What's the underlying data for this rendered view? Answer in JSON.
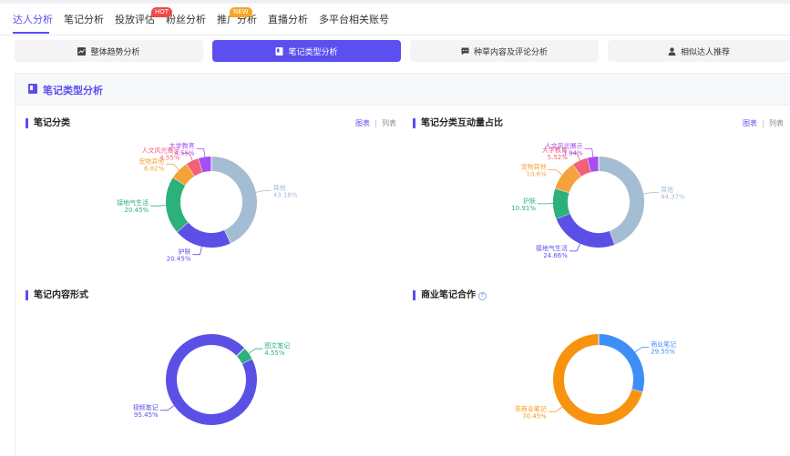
{
  "nav": {
    "items": [
      "达人分析",
      "笔记分析",
      "投放评估",
      "粉丝分析",
      "推广分析",
      "直播分析",
      "多平台相关账号"
    ],
    "active_index": 0,
    "badges": {
      "hot": "HOT",
      "new": "NEW"
    }
  },
  "subtabs": [
    {
      "label": "整体趋势分析",
      "icon": "trend-chart-icon"
    },
    {
      "label": "笔记类型分析",
      "icon": "note-icon"
    },
    {
      "label": "种草内容及评论分析",
      "icon": "comment-icon"
    },
    {
      "label": "相似达人推荐",
      "icon": "user-icon"
    }
  ],
  "active_subtab": 1,
  "panel": {
    "title": "笔记类型分析",
    "icon": "note-icon"
  },
  "toggle": {
    "chart": "图表",
    "list": "列表"
  },
  "colors": {
    "accent": "#5b4ff0",
    "other": "#a5bdd3",
    "skin": "#5b50e6",
    "green": "#2cb07c",
    "pet": "#f6a23c",
    "culture": "#f2607a",
    "edu": "#a64ef0",
    "orange": "#f7930f",
    "blue": "#3f8ef7"
  },
  "chart_data": [
    {
      "type": "pie",
      "title": "笔记分类",
      "slices": [
        {
          "label": "其他",
          "value": 43.18,
          "display": "43.18%",
          "color": "#a5bdd3"
        },
        {
          "label": "护肤",
          "value": 20.45,
          "display": "20.45%",
          "color": "#5b50e6"
        },
        {
          "label": "接地气生活",
          "value": 20.45,
          "display": "20.45%",
          "color": "#2cb07c"
        },
        {
          "label": "宠物其他",
          "value": 6.82,
          "display": "6.82%",
          "color": "#f6a23c"
        },
        {
          "label": "人文风光展示",
          "value": 4.55,
          "display": "4.55%",
          "color": "#f2607a"
        },
        {
          "label": "大学教育",
          "value": 4.55,
          "display": "4.55%",
          "color": "#a64ef0"
        }
      ]
    },
    {
      "type": "pie",
      "title": "笔记分类互动量占比",
      "slices": [
        {
          "label": "其他",
          "value": 44.37,
          "display": "44.37%",
          "color": "#a5bdd3"
        },
        {
          "label": "接地气生活",
          "value": 24.66,
          "display": "24.66%",
          "color": "#5b50e6"
        },
        {
          "label": "护肤",
          "value": 10.91,
          "display": "10.91%",
          "color": "#2cb07c"
        },
        {
          "label": "宠物其他",
          "value": 10.6,
          "display": "10.6%",
          "color": "#f6a23c"
        },
        {
          "label": "大学教育",
          "value": 5.52,
          "display": "5.52%",
          "color": "#f2607a"
        },
        {
          "label": "人文风光展示",
          "value": 3.94,
          "display": "3.94%",
          "color": "#a64ef0"
        }
      ]
    },
    {
      "type": "pie",
      "title": "笔记内容形式",
      "slices": [
        {
          "label": "图文笔记",
          "value": 4.55,
          "display": "4.55%",
          "color": "#2cb07c"
        },
        {
          "label": "视频笔记",
          "value": 95.45,
          "display": "95.45%",
          "color": "#5b50e6"
        }
      ]
    },
    {
      "type": "pie",
      "title": "商业笔记合作",
      "slices": [
        {
          "label": "商业笔记",
          "value": 29.55,
          "display": "29.55%",
          "color": "#3f8ef7"
        },
        {
          "label": "非商业笔记",
          "value": 70.45,
          "display": "70.45%",
          "color": "#f7930f"
        }
      ]
    }
  ]
}
